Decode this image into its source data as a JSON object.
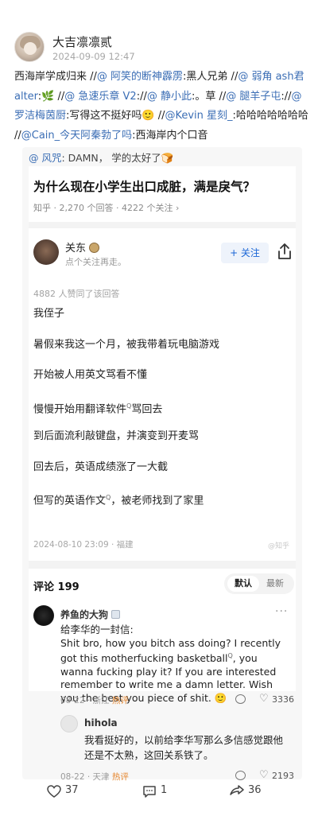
{
  "post": {
    "author": "大吉凛凛贰",
    "time": "2024-09-09 12:47"
  },
  "repost_chain": {
    "segments": [
      {
        "t": "西海岸学成归来 //",
        "u": false
      },
      {
        "t": "@ 阿笑的断神霹雳",
        "u": true
      },
      {
        "t": ":黑人兄弟 //",
        "u": false
      },
      {
        "t": "@ 弱角 ash君 alter",
        "u": true
      },
      {
        "t": ":🌿 //",
        "u": false
      },
      {
        "t": "@ 急速乐章 V2",
        "u": true
      },
      {
        "t": "://",
        "u": false
      },
      {
        "t": "@ 静小此",
        "u": true
      },
      {
        "t": ":。草 //",
        "u": false
      },
      {
        "t": "@ 腿羊子屯",
        "u": true
      },
      {
        "t": "://",
        "u": false
      },
      {
        "t": "@ 罗洁梅茵厨",
        "u": true
      },
      {
        "t": ":写得这不挺好吗🙂 //",
        "u": false
      },
      {
        "t": "@Kevin 星刻_",
        "u": true
      },
      {
        "t": ":哈哈哈哈哈哈哈 //",
        "u": false
      },
      {
        "t": "@Cain_今天阿秦勃了吗",
        "u": true
      },
      {
        "t": ":西海岸内个口音",
        "u": false
      }
    ]
  },
  "card": {
    "quote_user": "@ 风咒",
    "quote_text": ": DAMN， 学的太好了🍞"
  },
  "zhihu": {
    "question_title": "为什么现在小学生出口成脏，满是戾气？",
    "question_meta": "知乎 · 2,270 个回答 · 4222 个关注 ›",
    "answerer": "关东",
    "answerer_sub": "点个关注再走。",
    "follow_label": "+ 关注",
    "likes": "4882 人赞同了该回答",
    "paragraphs": [
      "我侄子",
      "暑假来我这一个月，被我带着玩电脑游戏",
      "开始被人用英文骂看不懂",
      "慢慢开始用翻译软件",
      "到后面流利敲键盘，并演变到开麦骂",
      "回去后，英语成绩涨了一大截",
      "但写的英语作文",
      "被老师找到了家里"
    ],
    "p4_tail": "骂回去",
    "sup_mark": "Q",
    "date": "2024-08-10 23:09 · 福建",
    "watermark": "@知乎"
  },
  "comments": {
    "header": "评论 199",
    "sort_default": "默认",
    "sort_latest": "最新",
    "c1": {
      "name": "养鱼的大狗",
      "body_line1": "给李华的一封信:",
      "body_en_a": "Shit bro, how you bitch ass doing? I recently got this motherfucking basketball",
      "body_en_b": ", you wanna fucking play it? If you are interested remember to write me a damn letter. Wish you the best you piece of shit.",
      "emoji": "🙂",
      "date": "08-22 · 浙江",
      "hot": "热评",
      "likes": "3336"
    },
    "c2": {
      "name": "hihola",
      "body": "我看挺好的，以前给李华写那么多信感觉跟他还是不太熟，这回关系铁了。",
      "date": "08-22 · 天津",
      "hot": "热评",
      "likes": "2193"
    }
  },
  "actions": {
    "likes": "37",
    "comments": "1",
    "reposts": "36"
  }
}
